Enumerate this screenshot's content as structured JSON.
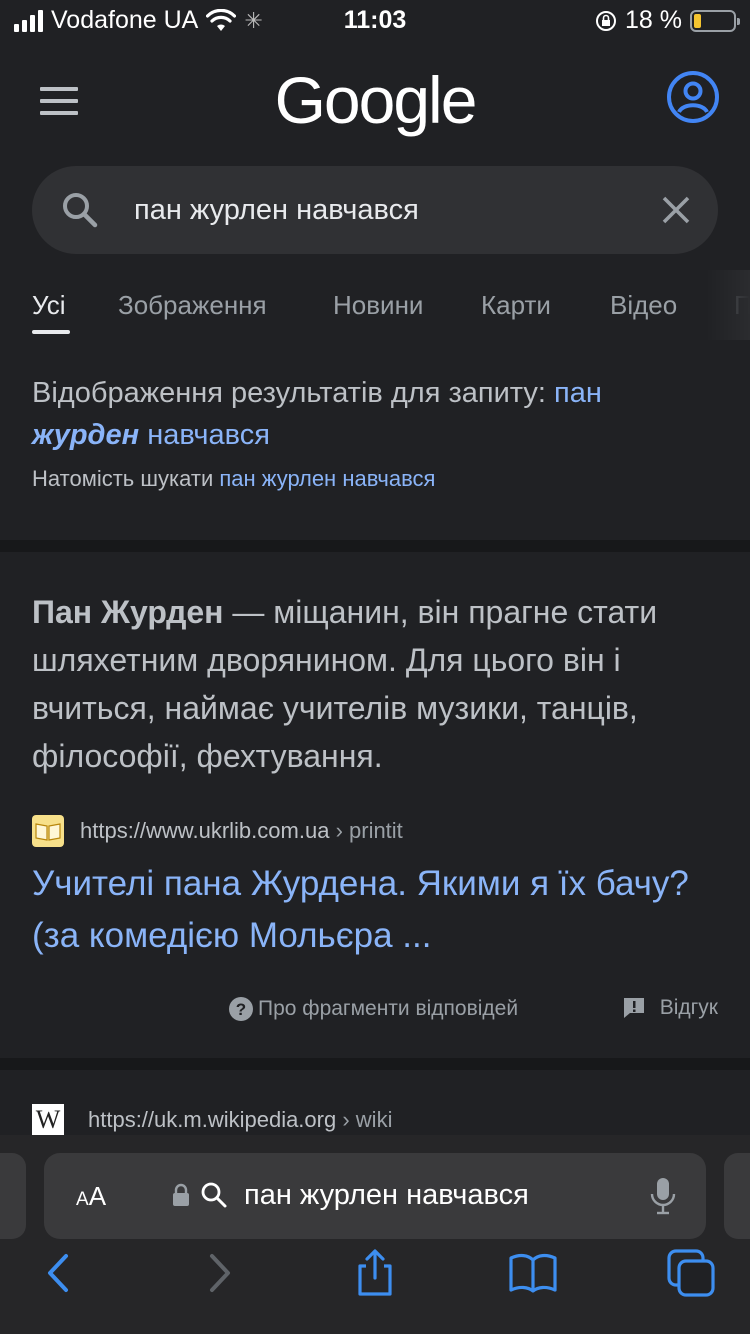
{
  "status_bar": {
    "carrier": "Vodafone UA",
    "time": "11:03",
    "battery_percent": "18 %",
    "battery_level": 0.18
  },
  "header": {
    "logo": "Google"
  },
  "search": {
    "query": "пан журлен навчався"
  },
  "tabs": [
    {
      "label": "Усі",
      "active": true
    },
    {
      "label": "Зображення"
    },
    {
      "label": "Новини"
    },
    {
      "label": "Карти"
    },
    {
      "label": "Відео"
    },
    {
      "label": "П"
    }
  ],
  "spelling": {
    "showing_prefix": "Відображення результатів для запиту:",
    "corrected_word1": "пан",
    "corrected_bold": "журден",
    "corrected_word3": "навчався",
    "instead_prefix": "Натомість шукати",
    "instead_query": "пан журлен навчався"
  },
  "featured_snippet": {
    "bold": "Пан Журден",
    "text": " — міщанин, він прагне стати шляхетним дворянином. Для цього він і вчиться, наймає учителів музики, танців, філософії, фехтування.",
    "source_url": "https://www.ukrlib.com.ua",
    "source_crumb": "› printit",
    "title": "Учителі пана Журдена. Якими я їх бачу? (за комедією Мольєра ...",
    "about_label": "Про фрагменти відповідей",
    "feedback_label": "Відгук"
  },
  "next_result": {
    "favicon": "W",
    "source_url": "https://uk.m.wikipedia.org",
    "source_crumb": "› wiki"
  },
  "safari": {
    "aa_label_small": "A",
    "aa_label_big": "A",
    "address_text": "пан журлен навчався"
  },
  "colors": {
    "background": "#202124",
    "link": "#8ab4f8",
    "text": "#bdc1c6",
    "account_icon": "#4285f4",
    "toolbar_icon": "#3d8ef0"
  },
  "icons": [
    "menu-icon",
    "account-icon",
    "search-icon",
    "clear-icon",
    "help-icon",
    "feedback-icon",
    "lock-icon",
    "mic-icon",
    "back-icon",
    "forward-icon",
    "share-icon",
    "bookmarks-icon",
    "tabs-icon"
  ]
}
